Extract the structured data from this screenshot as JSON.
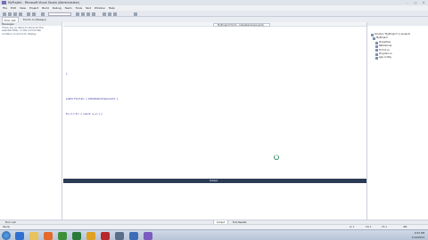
{
  "titlebar": {
    "title": "MyProject - Microsoft Visual Studio (Administrator)"
  },
  "menubar": {
    "items": [
      "File",
      "Edit",
      "View",
      "Project",
      "Build",
      "Debug",
      "Team",
      "Tools",
      "Test",
      "Window",
      "Help"
    ]
  },
  "tabs": [
    {
      "label": "Error List"
    },
    {
      "label": "Form1.cs [Design]"
    }
  ],
  "error_list": {
    "header": "Messages",
    "message": "There are no items to show for the selected filter, or the current tab contains no errors to display."
  },
  "editor": {
    "nav_selector": "MyProject.Form1 - InitializeComponent()",
    "code_lines": [
      {
        "text": "}",
        "cls": "dim"
      },
      {
        "text": "public Form1(); { InitializeComponent(); }",
        "cls": "kw"
      },
      {
        "text": "for (i = 0; i < count; i++) { }",
        "cls": "kw"
      }
    ]
  },
  "solution_explorer": {
    "nodes": [
      {
        "label": "Solution 'MyProject' (1 project)"
      },
      {
        "label": "MyProject"
      },
      {
        "label": "Properties"
      },
      {
        "label": "References"
      },
      {
        "label": "Form1.cs"
      },
      {
        "label": "Program.cs"
      },
      {
        "label": "app.config"
      }
    ]
  },
  "output_dock": {
    "caption": "Output"
  },
  "bottom_tabs": [
    {
      "label": "Error List"
    },
    {
      "label": "Output"
    },
    {
      "label": "Find Results"
    }
  ],
  "statusbar": {
    "ready": "Ready",
    "ln": "Ln 1",
    "col": "Col 1",
    "ch": "Ch 1",
    "ins": "INS"
  },
  "taskbar": {
    "time": "4:52 PM",
    "date": "1/14/2013"
  }
}
